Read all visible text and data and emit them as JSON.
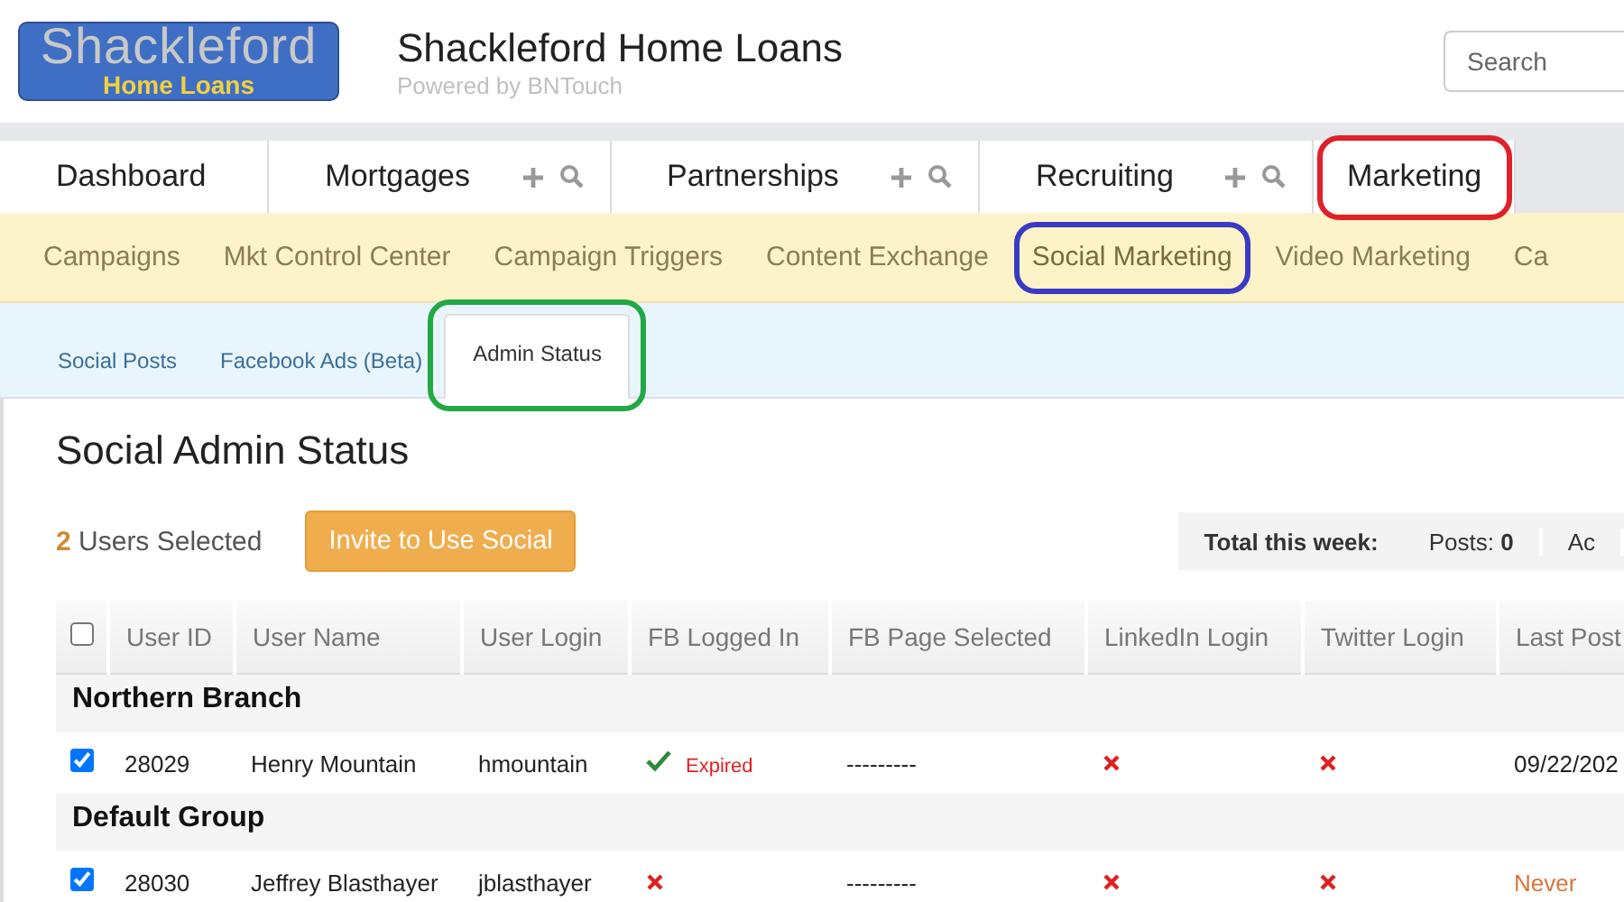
{
  "header": {
    "logo": {
      "line1": "Shackleford",
      "line2": "Home Loans"
    },
    "title": "Shackleford Home Loans",
    "subtitle": "Powered by BNTouch",
    "search": {
      "placeholder": "Search"
    }
  },
  "main_tabs": [
    {
      "label": "Dashboard",
      "selected": false,
      "actions": false
    },
    {
      "label": "Mortgages",
      "selected": false,
      "actions": true
    },
    {
      "label": "Partnerships",
      "selected": false,
      "actions": true
    },
    {
      "label": "Recruiting",
      "selected": false,
      "actions": true
    },
    {
      "label": "Marketing",
      "selected": true,
      "actions": false,
      "color": "#e0202a"
    }
  ],
  "sub_nav": [
    {
      "label": "Campaigns",
      "selected": false
    },
    {
      "label": "Mkt Control Center",
      "selected": false
    },
    {
      "label": "Campaign Triggers",
      "selected": false
    },
    {
      "label": "Content Exchange",
      "selected": false
    },
    {
      "label": "Social Marketing",
      "selected": true,
      "color": "#3a3ac4"
    },
    {
      "label": "Video Marketing",
      "selected": false
    },
    {
      "label": "Ca",
      "selected": false
    }
  ],
  "section_tabs": [
    {
      "label": "Social Posts",
      "selected": false
    },
    {
      "label": "Facebook Ads (Beta)",
      "selected": false
    },
    {
      "label": "Admin Status",
      "selected": true,
      "color": "#22a845"
    }
  ],
  "page_title": "Social Admin Status",
  "selection": {
    "count": "2",
    "label": "Users Selected"
  },
  "invite_button": "Invite to Use Social",
  "stats": {
    "label": "Total this week:",
    "items": [
      {
        "label": "Posts:",
        "value": "0"
      },
      {
        "label": "Ac"
      }
    ]
  },
  "table": {
    "select_all_checked": false,
    "columns": [
      "User ID",
      "User Name",
      "User Login",
      "FB Logged In",
      "FB Page Selected",
      "LinkedIn Login",
      "Twitter Login",
      "Last Post"
    ],
    "groups": [
      {
        "name": "Northern Branch",
        "rows": [
          {
            "checked": true,
            "user_id": "28029",
            "user_name": "Henry Mountain",
            "user_login": "hmountain",
            "fb_logged_in": true,
            "fb_note": "Expired",
            "fb_page": "---------",
            "linkedin_logged_in": false,
            "twitter_logged_in": false,
            "last_post": "09/22/202",
            "never_posted": false
          }
        ]
      },
      {
        "name": "Default Group",
        "rows": [
          {
            "checked": true,
            "user_id": "28030",
            "user_name": "Jeffrey Blasthayer",
            "user_login": "jblasthayer",
            "fb_logged_in": false,
            "fb_page": "---------",
            "linkedin_logged_in": false,
            "twitter_logged_in": false,
            "last_post": "Never",
            "never_posted": true
          }
        ]
      }
    ]
  }
}
